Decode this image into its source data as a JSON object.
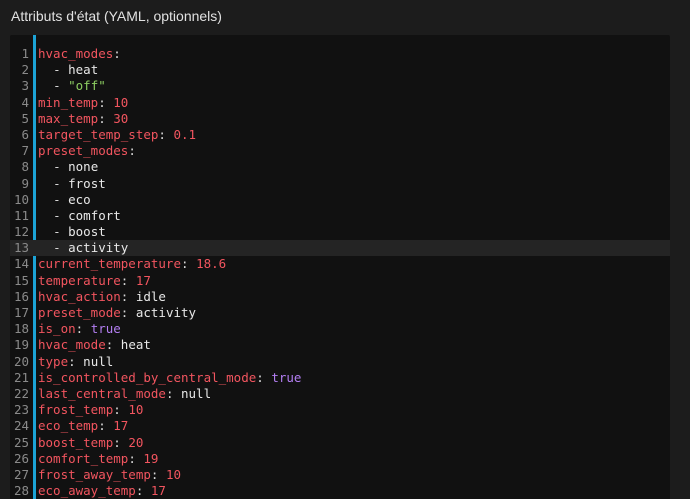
{
  "section": {
    "title": "Attributs d'état (YAML, optionnels)"
  },
  "editor": {
    "active_line": 13,
    "accent_color": "#1ca3d6",
    "colors": {
      "key": "#f2555f",
      "number": "#f2555f",
      "string": "#8ecf62",
      "boolean": "#b37ef2",
      "plain": "#e8e8e8"
    },
    "lines": [
      {
        "num": "1",
        "indent": "",
        "dash": "",
        "key": "hvac_modes",
        "value": "",
        "type": "none"
      },
      {
        "num": "2",
        "indent": "  ",
        "dash": "- ",
        "key": "",
        "value": "heat",
        "type": "plain"
      },
      {
        "num": "3",
        "indent": "  ",
        "dash": "- ",
        "key": "",
        "value": "\"off\"",
        "type": "string"
      },
      {
        "num": "4",
        "indent": "",
        "dash": "",
        "key": "min_temp",
        "value": "10",
        "type": "number"
      },
      {
        "num": "5",
        "indent": "",
        "dash": "",
        "key": "max_temp",
        "value": "30",
        "type": "number"
      },
      {
        "num": "6",
        "indent": "",
        "dash": "",
        "key": "target_temp_step",
        "value": "0.1",
        "type": "number"
      },
      {
        "num": "7",
        "indent": "",
        "dash": "",
        "key": "preset_modes",
        "value": "",
        "type": "none"
      },
      {
        "num": "8",
        "indent": "  ",
        "dash": "- ",
        "key": "",
        "value": "none",
        "type": "plain"
      },
      {
        "num": "9",
        "indent": "  ",
        "dash": "- ",
        "key": "",
        "value": "frost",
        "type": "plain"
      },
      {
        "num": "10",
        "indent": "  ",
        "dash": "- ",
        "key": "",
        "value": "eco",
        "type": "plain"
      },
      {
        "num": "11",
        "indent": "  ",
        "dash": "- ",
        "key": "",
        "value": "comfort",
        "type": "plain"
      },
      {
        "num": "12",
        "indent": "  ",
        "dash": "- ",
        "key": "",
        "value": "boost",
        "type": "plain"
      },
      {
        "num": "13",
        "indent": "  ",
        "dash": "- ",
        "key": "",
        "value": "activity",
        "type": "plain"
      },
      {
        "num": "14",
        "indent": "",
        "dash": "",
        "key": "current_temperature",
        "value": "18.6",
        "type": "number"
      },
      {
        "num": "15",
        "indent": "",
        "dash": "",
        "key": "temperature",
        "value": "17",
        "type": "number"
      },
      {
        "num": "16",
        "indent": "",
        "dash": "",
        "key": "hvac_action",
        "value": "idle",
        "type": "plain"
      },
      {
        "num": "17",
        "indent": "",
        "dash": "",
        "key": "preset_mode",
        "value": "activity",
        "type": "plain"
      },
      {
        "num": "18",
        "indent": "",
        "dash": "",
        "key": "is_on",
        "value": "true",
        "type": "boolean"
      },
      {
        "num": "19",
        "indent": "",
        "dash": "",
        "key": "hvac_mode",
        "value": "heat",
        "type": "plain"
      },
      {
        "num": "20",
        "indent": "",
        "dash": "",
        "key": "type",
        "value": "null",
        "type": "null"
      },
      {
        "num": "21",
        "indent": "",
        "dash": "",
        "key": "is_controlled_by_central_mode",
        "value": "true",
        "type": "boolean"
      },
      {
        "num": "22",
        "indent": "",
        "dash": "",
        "key": "last_central_mode",
        "value": "null",
        "type": "null"
      },
      {
        "num": "23",
        "indent": "",
        "dash": "",
        "key": "frost_temp",
        "value": "10",
        "type": "number"
      },
      {
        "num": "24",
        "indent": "",
        "dash": "",
        "key": "eco_temp",
        "value": "17",
        "type": "number"
      },
      {
        "num": "25",
        "indent": "",
        "dash": "",
        "key": "boost_temp",
        "value": "20",
        "type": "number"
      },
      {
        "num": "26",
        "indent": "",
        "dash": "",
        "key": "comfort_temp",
        "value": "19",
        "type": "number"
      },
      {
        "num": "27",
        "indent": "",
        "dash": "",
        "key": "frost_away_temp",
        "value": "10",
        "type": "number"
      },
      {
        "num": "28",
        "indent": "",
        "dash": "",
        "key": "eco_away_temp",
        "value": "17",
        "type": "number"
      }
    ]
  }
}
